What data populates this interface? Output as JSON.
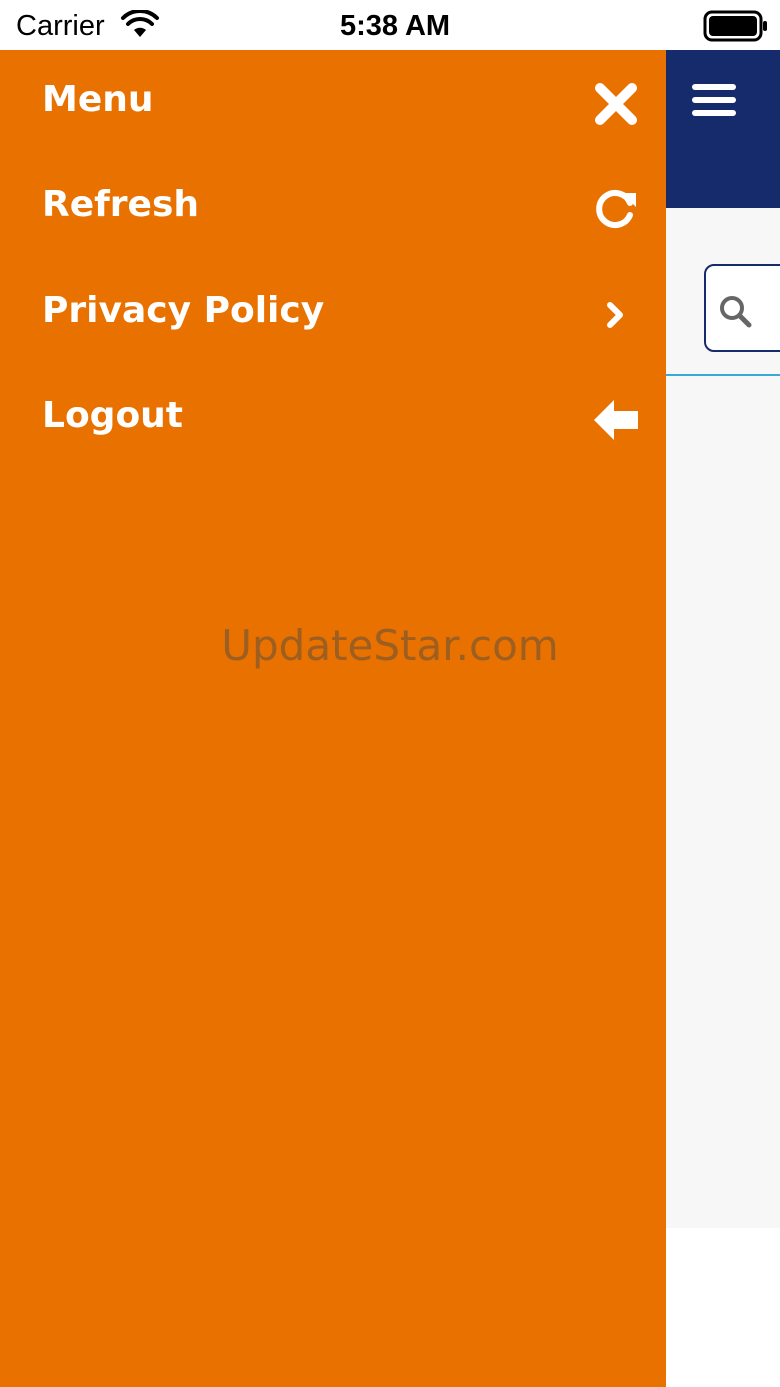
{
  "status_bar": {
    "carrier": "Carrier",
    "time": "5:38 AM",
    "icons": [
      "wifi-icon",
      "battery-icon"
    ]
  },
  "drawer": {
    "background_color": "#e87100",
    "items": [
      {
        "label": "Menu",
        "icon": "close-icon"
      },
      {
        "label": "Refresh",
        "icon": "refresh-icon"
      },
      {
        "label": "Privacy Policy",
        "icon": "chevron-right-icon"
      },
      {
        "label": "Logout",
        "icon": "arrow-left-icon"
      }
    ]
  },
  "main": {
    "header_color": "#162b6b",
    "menu_icon": "hamburger-icon",
    "search_icon": "search-icon",
    "accent_color": "#39a9d6"
  },
  "watermark": "UpdateStar.com"
}
